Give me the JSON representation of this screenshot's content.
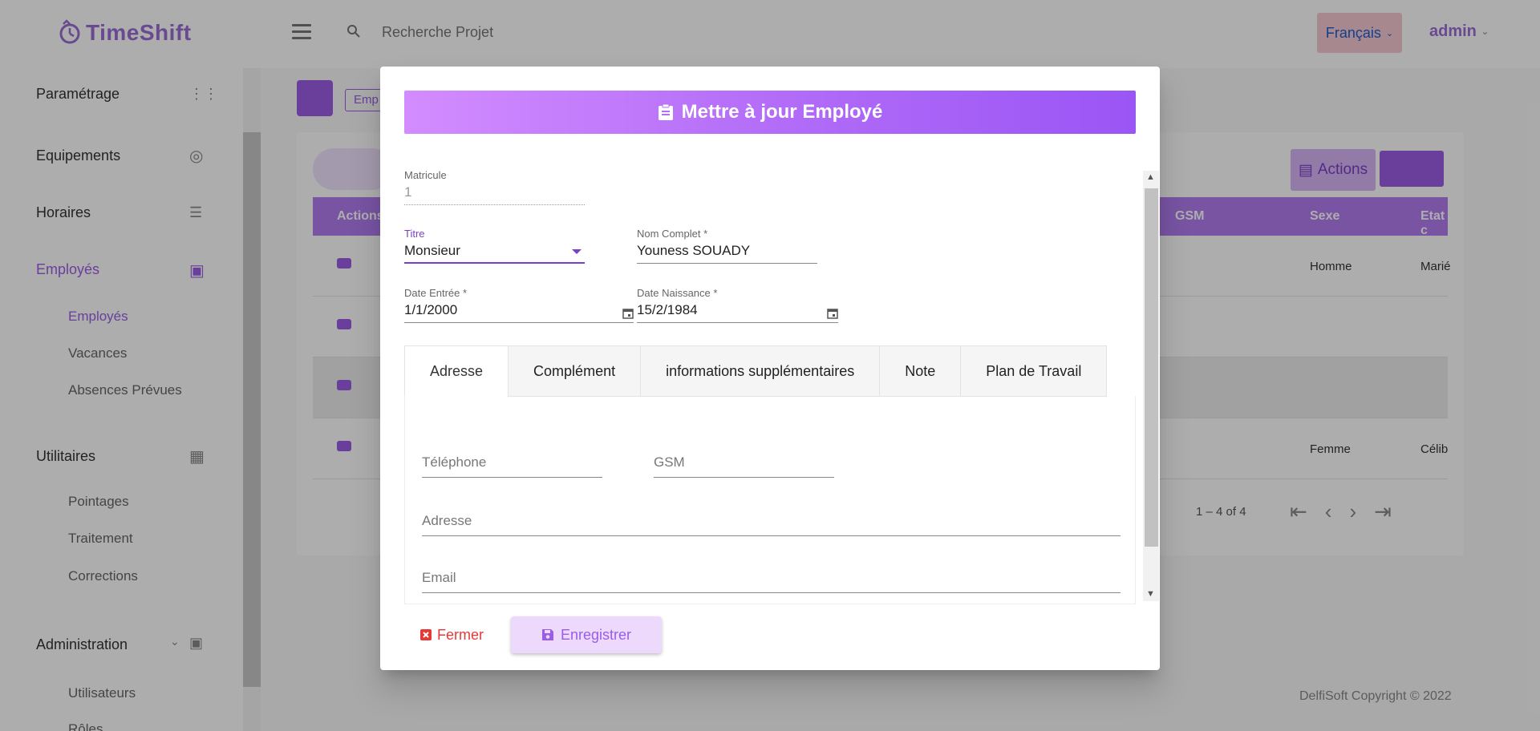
{
  "topbar": {
    "logo_text": "TimeShift",
    "search_placeholder": "Recherche Projet",
    "language": "Français",
    "user": "admin"
  },
  "sidebar": {
    "parametrage": "Paramétrage",
    "equipements": "Equipements",
    "horaires": "Horaires",
    "employes": "Employés",
    "employes_sub": "Employés",
    "vacances": "Vacances",
    "absences": "Absences Prévues",
    "utilitaires": "Utilitaires",
    "pointages": "Pointages",
    "traitement": "Traitement",
    "corrections": "Corrections",
    "administration": "Administration",
    "utilisateurs": "Utilisateurs",
    "roles": "Rôles"
  },
  "background": {
    "breadcrumb": "Emp",
    "actions_label": "Actions",
    "columns": [
      "Actions",
      "GSM",
      "Sexe",
      "Etat c"
    ],
    "rows": [
      {
        "sexe": "Homme",
        "etat": "Marié"
      },
      {
        "sexe": "",
        "etat": ""
      },
      {
        "sexe": "",
        "etat": ""
      },
      {
        "sexe": "Femme",
        "etat": "Célib"
      }
    ],
    "pager": "1 – 4 of 4",
    "footer": "DelfiSoft Copyright © 2022"
  },
  "dialog": {
    "title": "Mettre à jour Employé",
    "matricule": {
      "label": "Matricule",
      "value": "1"
    },
    "titre": {
      "label": "Titre",
      "value": "Monsieur"
    },
    "nom": {
      "label": "Nom Complet *",
      "value": "Youness SOUADY"
    },
    "date_entree": {
      "label": "Date Entrée *",
      "value": "1/1/2000"
    },
    "date_naissance": {
      "label": "Date Naissance *",
      "value": "15/2/1984"
    },
    "tabs": [
      "Adresse",
      "Complément",
      "informations supplémentaires",
      "Note",
      "Plan de Travail"
    ],
    "telephone_placeholder": "Téléphone",
    "gsm_placeholder": "GSM",
    "adresse_placeholder": "Adresse",
    "email_placeholder": "Email",
    "close_label": "Fermer",
    "save_label": "Enregistrer"
  },
  "colors": {
    "accent": "#9b5de5",
    "header_gradient_start": "#d38cff",
    "header_gradient_end": "#9a55f5",
    "danger": "#e53935"
  }
}
